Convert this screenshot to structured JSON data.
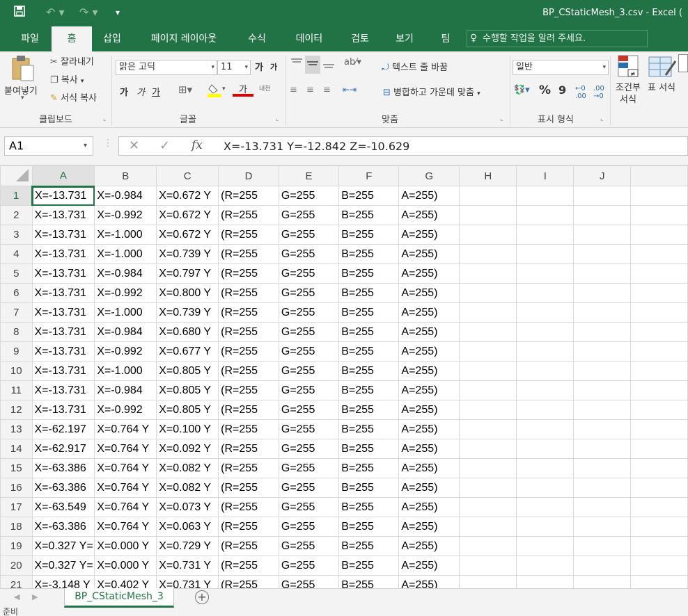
{
  "window": {
    "title": "BP_CStaticMesh_3.csv - Excel ("
  },
  "tabs": [
    "파일",
    "홈",
    "삽입",
    "페이지 레이아웃",
    "수식",
    "데이터",
    "검토",
    "보기",
    "팀"
  ],
  "tell_me": "수행할 작업을 알려 주세요.",
  "ribbon": {
    "clipboard": {
      "paste": "붙여넣기",
      "cut": "잘라내기",
      "copy": "복사",
      "format_painter": "서식 복사",
      "label": "클립보드"
    },
    "font": {
      "name": "맑은 고딕",
      "size": "11",
      "grow": "가",
      "shrink": "가",
      "bold": "가",
      "italic": "가",
      "underline": "가",
      "font_color": "가",
      "phonetic": "내천",
      "label": "글꼴"
    },
    "align": {
      "wrap": "텍스트 줄 바꿈",
      "merge": "병합하고 가운데 맞춤",
      "label": "맞춤"
    },
    "number": {
      "format": "일반",
      "percent": "%",
      "comma": "9",
      "label": "표시 형식"
    },
    "styles": {
      "conditional": "조건부 서식",
      "table": "표 서식"
    }
  },
  "formula_bar": {
    "namebox": "A1",
    "fx": "fx",
    "formula": "X=-13.731 Y=-12.842 Z=-10.629"
  },
  "columns": [
    "A",
    "B",
    "C",
    "D",
    "E",
    "F",
    "G",
    "H",
    "I",
    "J"
  ],
  "rows": [
    [
      "X=-13.731",
      "X=-0.984",
      "X=0.672 Y",
      "(R=255",
      "G=255",
      "B=255",
      "A=255)"
    ],
    [
      "X=-13.731",
      "X=-0.992",
      "X=0.672 Y",
      "(R=255",
      "G=255",
      "B=255",
      "A=255)"
    ],
    [
      "X=-13.731",
      "X=-1.000",
      "X=0.672 Y",
      "(R=255",
      "G=255",
      "B=255",
      "A=255)"
    ],
    [
      "X=-13.731",
      "X=-1.000",
      "X=0.739 Y",
      "(R=255",
      "G=255",
      "B=255",
      "A=255)"
    ],
    [
      "X=-13.731",
      "X=-0.984",
      "X=0.797 Y",
      "(R=255",
      "G=255",
      "B=255",
      "A=255)"
    ],
    [
      "X=-13.731",
      "X=-0.992",
      "X=0.800 Y",
      "(R=255",
      "G=255",
      "B=255",
      "A=255)"
    ],
    [
      "X=-13.731",
      "X=-1.000",
      "X=0.739 Y",
      "(R=255",
      "G=255",
      "B=255",
      "A=255)"
    ],
    [
      "X=-13.731",
      "X=-0.984",
      "X=0.680 Y",
      "(R=255",
      "G=255",
      "B=255",
      "A=255)"
    ],
    [
      "X=-13.731",
      "X=-0.992",
      "X=0.677 Y",
      "(R=255",
      "G=255",
      "B=255",
      "A=255)"
    ],
    [
      "X=-13.731",
      "X=-1.000",
      "X=0.805 Y",
      "(R=255",
      "G=255",
      "B=255",
      "A=255)"
    ],
    [
      "X=-13.731",
      "X=-0.984",
      "X=0.805 Y",
      "(R=255",
      "G=255",
      "B=255",
      "A=255)"
    ],
    [
      "X=-13.731",
      "X=-0.992",
      "X=0.805 Y",
      "(R=255",
      "G=255",
      "B=255",
      "A=255)"
    ],
    [
      "X=-62.197",
      "X=0.764 Y",
      "X=0.100 Y",
      "(R=255",
      "G=255",
      "B=255",
      "A=255)"
    ],
    [
      "X=-62.917",
      "X=0.764 Y",
      "X=0.092 Y",
      "(R=255",
      "G=255",
      "B=255",
      "A=255)"
    ],
    [
      "X=-63.386",
      "X=0.764 Y",
      "X=0.082 Y",
      "(R=255",
      "G=255",
      "B=255",
      "A=255)"
    ],
    [
      "X=-63.386",
      "X=0.764 Y",
      "X=0.082 Y",
      "(R=255",
      "G=255",
      "B=255",
      "A=255)"
    ],
    [
      "X=-63.549",
      "X=0.764 Y",
      "X=0.073 Y",
      "(R=255",
      "G=255",
      "B=255",
      "A=255)"
    ],
    [
      "X=-63.386",
      "X=0.764 Y",
      "X=0.063 Y",
      "(R=255",
      "G=255",
      "B=255",
      "A=255)"
    ],
    [
      "X=0.327 Y=",
      "X=0.000 Y",
      "X=0.729 Y",
      "(R=255",
      "G=255",
      "B=255",
      "A=255)"
    ],
    [
      "X=0.327 Y=",
      "X=0.000 Y",
      "X=0.731 Y",
      "(R=255",
      "G=255",
      "B=255",
      "A=255)"
    ],
    [
      "X=-3.148 Y",
      "X=0.402 Y",
      "X=0.731 Y",
      "(R=255",
      "G=255",
      "B=255",
      "A=255)"
    ]
  ],
  "sheet_tab": "BP_CStaticMesh_3",
  "status": "준비",
  "colors": {
    "accent": "#217346"
  }
}
